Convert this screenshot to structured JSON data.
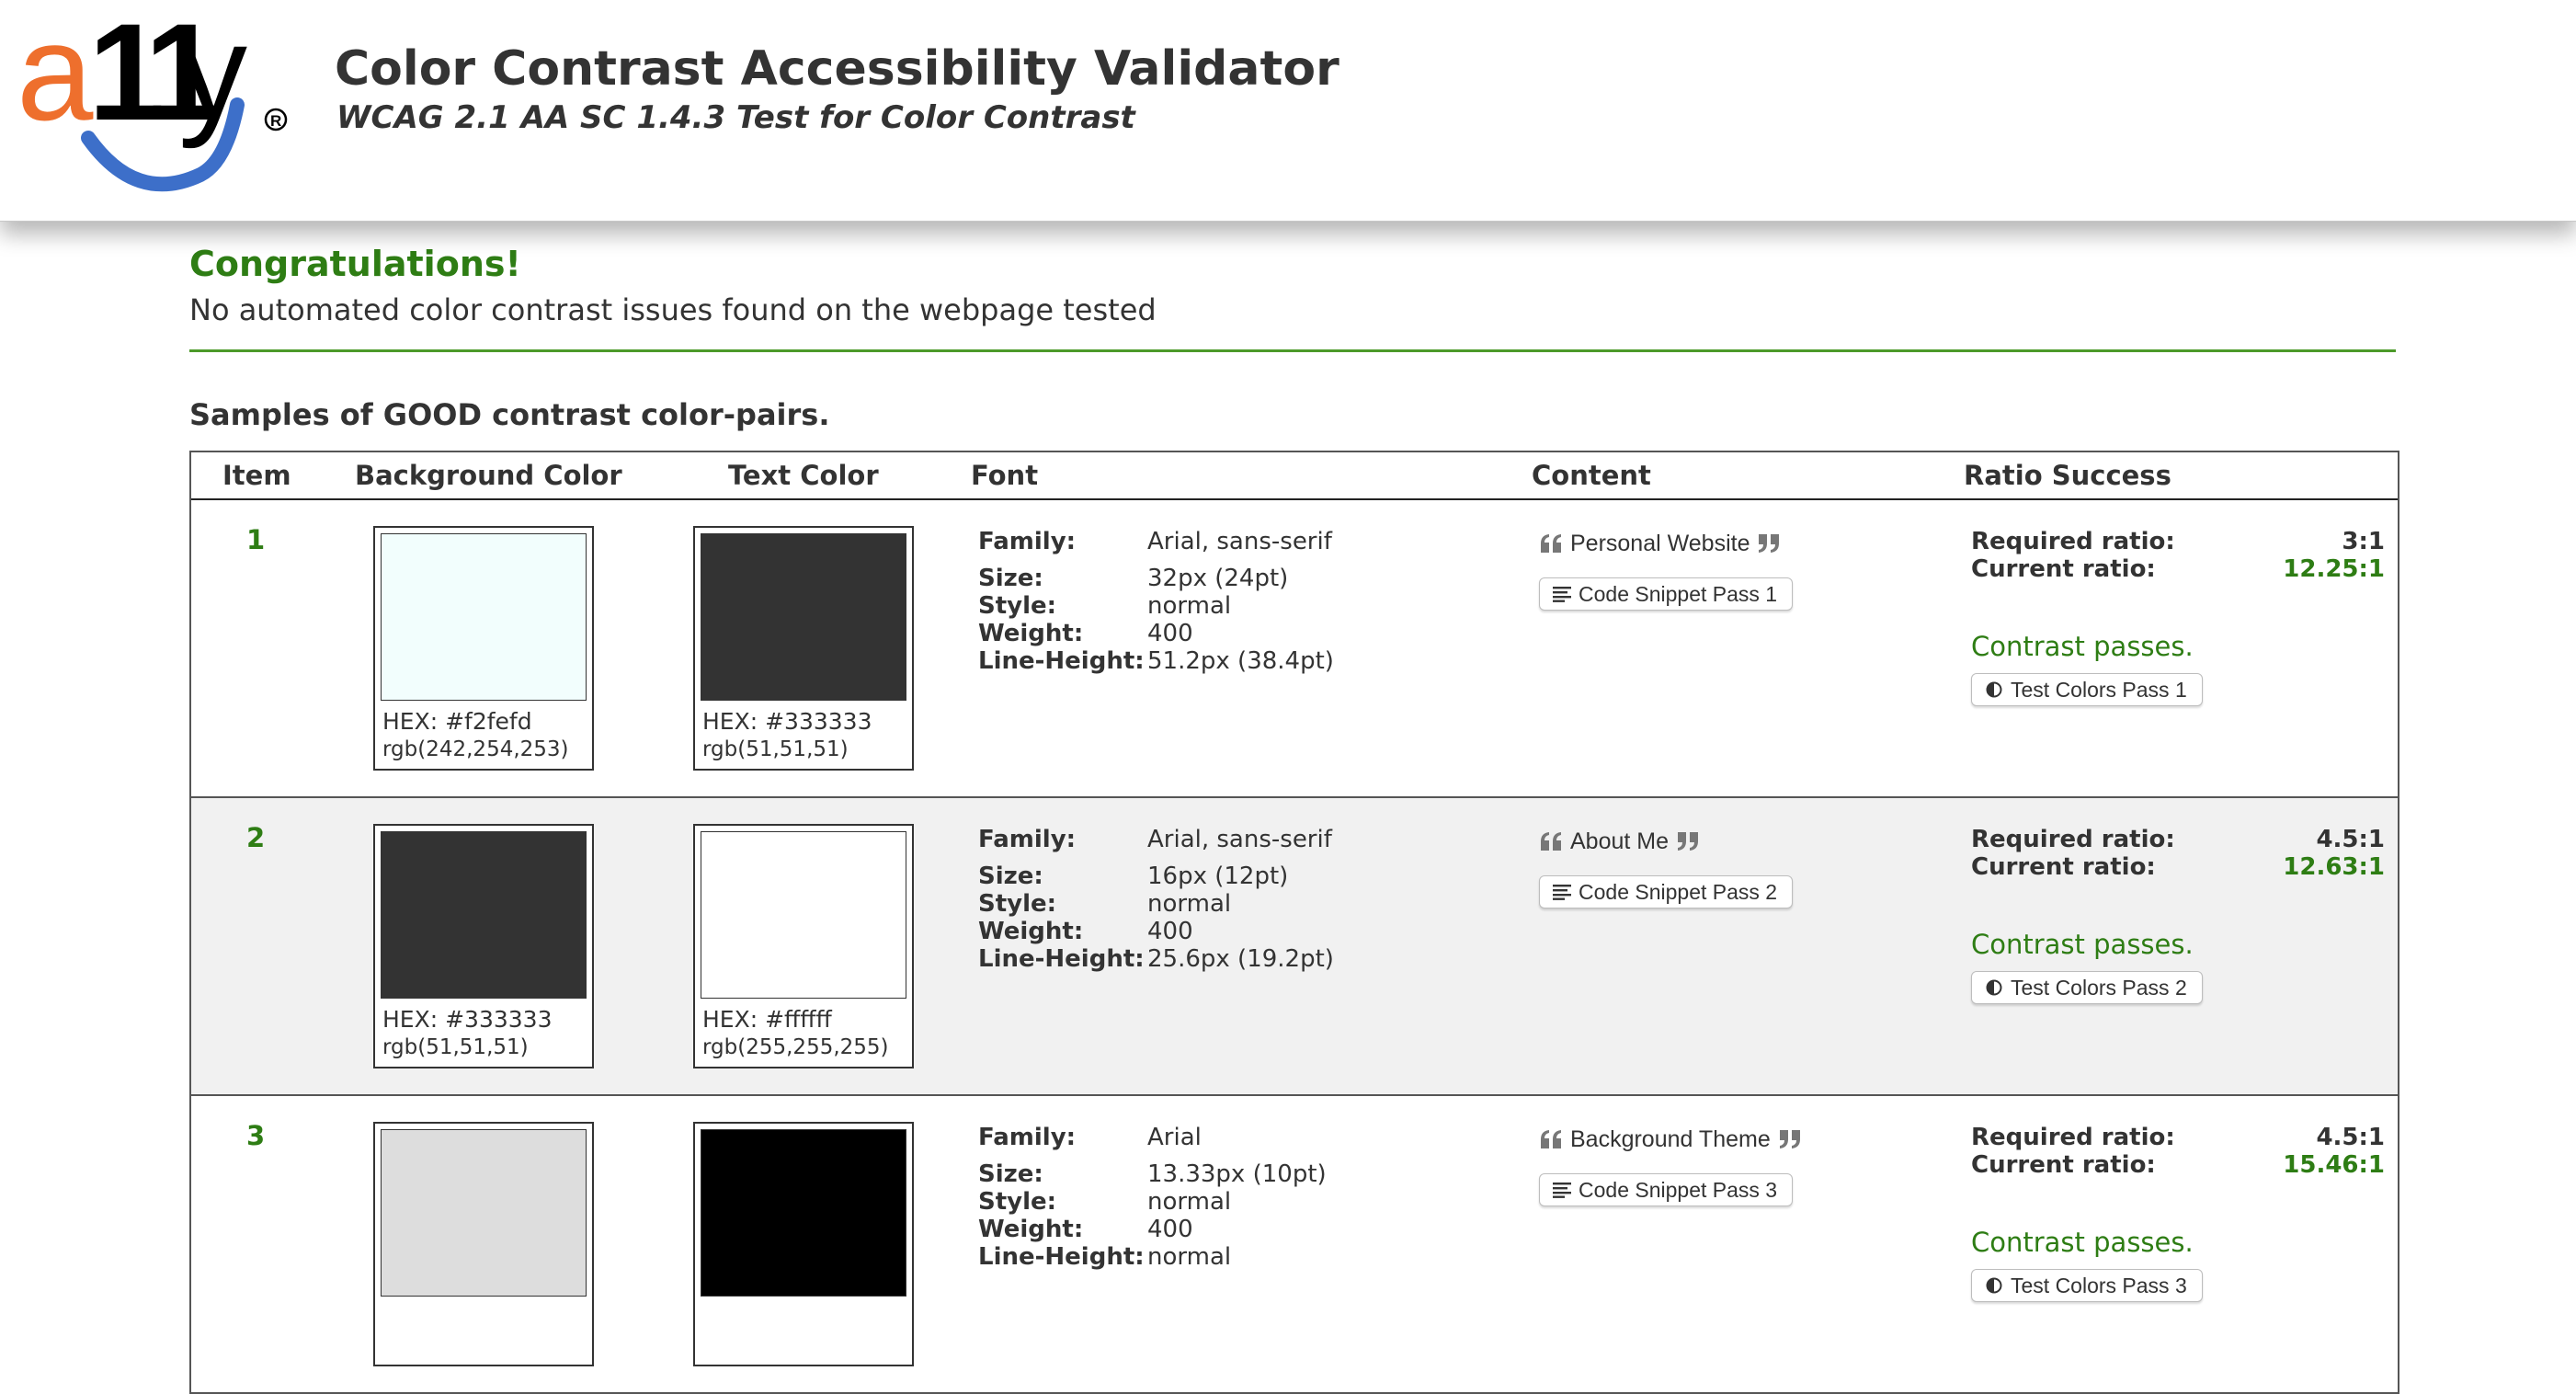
{
  "header": {
    "logo_text": "a11y",
    "logo_registered": "®",
    "title": "Color Contrast Accessibility Validator",
    "subtitle": "WCAG 2.1 AA SC 1.4.3 Test for Color Contrast"
  },
  "result": {
    "headline": "Congratulations!",
    "summary": "No automated color contrast issues found on the webpage tested",
    "samples_heading": "Samples of GOOD contrast color-pairs."
  },
  "table": {
    "headers": {
      "item": "Item",
      "background": "Background Color",
      "text": "Text Color",
      "font": "Font",
      "content": "Content",
      "ratio": "Ratio Success"
    },
    "labels": {
      "family": "Family:",
      "size": "Size:",
      "style": "Style:",
      "weight": "Weight:",
      "line_height": "Line-Height:",
      "required_ratio": "Required ratio:",
      "current_ratio": "Current ratio:"
    },
    "rows": [
      {
        "item": "1",
        "bg_color": "#f2fefd",
        "bg_hex": "HEX: #f2fefd",
        "bg_rgb": "rgb(242,254,253)",
        "fg_color": "#333333",
        "fg_hex": "HEX: #333333",
        "fg_rgb": "rgb(51,51,51)",
        "family": "Arial, sans-serif",
        "size": "32px (24pt)",
        "style": "normal",
        "weight": "400",
        "line_height": "51.2px (38.4pt)",
        "content": "Personal Website",
        "snippet_button": "Code Snippet Pass 1",
        "required_ratio": "3:1",
        "current_ratio": "12.25:1",
        "status": "Contrast passes.",
        "test_button": "Test Colors Pass 1"
      },
      {
        "item": "2",
        "bg_color": "#333333",
        "bg_hex": "HEX: #333333",
        "bg_rgb": "rgb(51,51,51)",
        "fg_color": "#ffffff",
        "fg_hex": "HEX: #ffffff",
        "fg_rgb": "rgb(255,255,255)",
        "family": "Arial, sans-serif",
        "size": "16px (12pt)",
        "style": "normal",
        "weight": "400",
        "line_height": "25.6px (19.2pt)",
        "content": "About Me",
        "snippet_button": "Code Snippet Pass 2",
        "required_ratio": "4.5:1",
        "current_ratio": "12.63:1",
        "status": "Contrast passes.",
        "test_button": "Test Colors Pass 2"
      },
      {
        "item": "3",
        "bg_color": "#dddddd",
        "bg_hex": "",
        "bg_rgb": "",
        "fg_color": "#000000",
        "fg_hex": "",
        "fg_rgb": "",
        "family": "Arial",
        "size": "13.33px (10pt)",
        "style": "normal",
        "weight": "400",
        "line_height": "normal",
        "content": "Background Theme",
        "snippet_button": "Code Snippet Pass 3",
        "required_ratio": "4.5:1",
        "current_ratio": "15.46:1",
        "status": "Contrast passes.",
        "test_button": "Test Colors Pass 3"
      }
    ]
  },
  "colors": {
    "success": "#2e7d14",
    "text": "#333333",
    "logo_orange": "#ee6f2d",
    "logo_blue": "#3d6fc9"
  },
  "icons": {
    "quote_open": "quote-open-icon",
    "quote_close": "quote-close-icon",
    "snippet": "code-lines-icon",
    "contrast": "contrast-icon"
  }
}
